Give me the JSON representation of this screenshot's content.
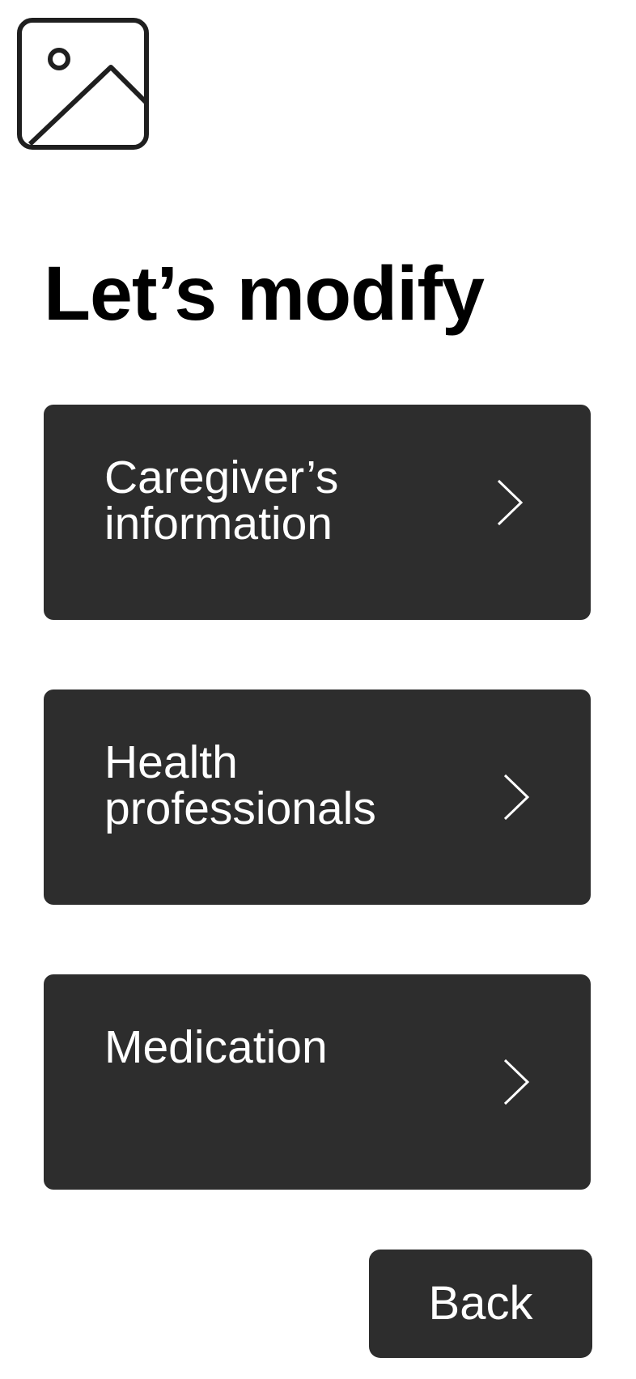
{
  "header": {
    "logo_icon": "image-placeholder-icon"
  },
  "title": "Let’s modify",
  "menu": {
    "items": [
      {
        "label": "Caregiver’s information",
        "icon": "chevron-right-icon"
      },
      {
        "label": "Health professionals",
        "icon": "chevron-right-icon"
      },
      {
        "label": "Medication",
        "icon": "chevron-right-icon"
      }
    ]
  },
  "footer": {
    "back_label": "Back"
  },
  "colors": {
    "background": "#ffffff",
    "card": "#2d2d2d",
    "text_on_card": "#ffffff",
    "title": "#000000"
  }
}
